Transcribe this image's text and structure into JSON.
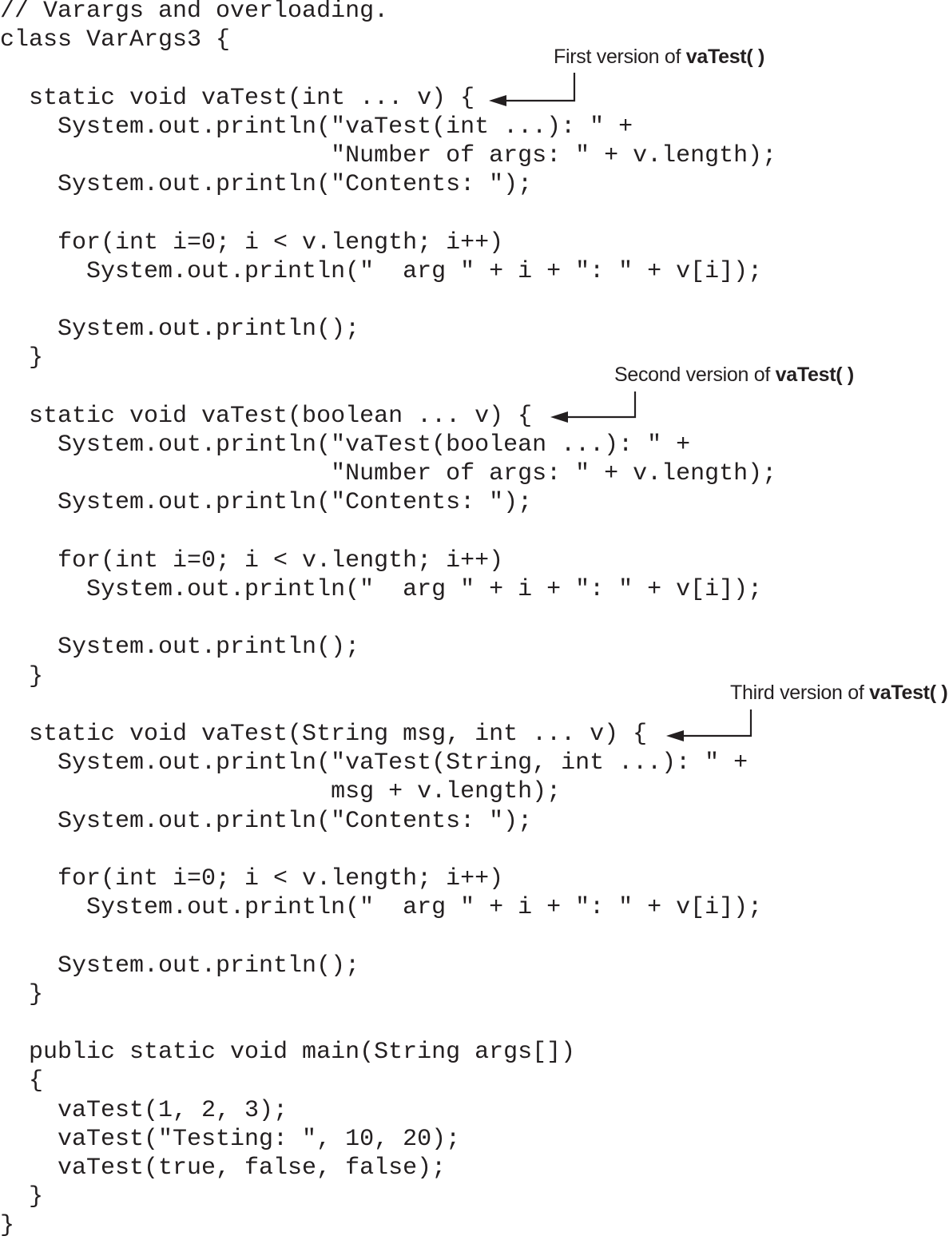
{
  "code_lines": [
    "// Varargs and overloading.",
    "class VarArgs3 {",
    "",
    "  static void vaTest(int ... v) {",
    "    System.out.println(\"vaTest(int ...): \" +",
    "                       \"Number of args: \" + v.length);",
    "    System.out.println(\"Contents: \");",
    "",
    "    for(int i=0; i < v.length; i++)",
    "      System.out.println(\"  arg \" + i + \": \" + v[i]);",
    "",
    "    System.out.println();",
    "  }",
    "",
    "  static void vaTest(boolean ... v) {",
    "    System.out.println(\"vaTest(boolean ...): \" +",
    "                       \"Number of args: \" + v.length);",
    "    System.out.println(\"Contents: \");",
    "",
    "    for(int i=0; i < v.length; i++)",
    "      System.out.println(\"  arg \" + i + \": \" + v[i]);",
    "",
    "    System.out.println();",
    "  }",
    "",
    "  static void vaTest(String msg, int ... v) {",
    "    System.out.println(\"vaTest(String, int ...): \" +",
    "                       msg + v.length);",
    "    System.out.println(\"Contents: \");",
    "",
    "    for(int i=0; i < v.length; i++)",
    "      System.out.println(\"  arg \" + i + \": \" + v[i]);",
    "",
    "    System.out.println();",
    "  }",
    "",
    "  public static void main(String args[])",
    "  {",
    "    vaTest(1, 2, 3);",
    "    vaTest(\"Testing: \", 10, 20);",
    "    vaTest(true, false, false);",
    "  }",
    "}"
  ],
  "callouts": [
    {
      "prefix": "First version of ",
      "bold": "vaTest( )"
    },
    {
      "prefix": "Second version of ",
      "bold": "vaTest( )"
    },
    {
      "prefix": "Third version of ",
      "bold": "vaTest( )"
    }
  ]
}
